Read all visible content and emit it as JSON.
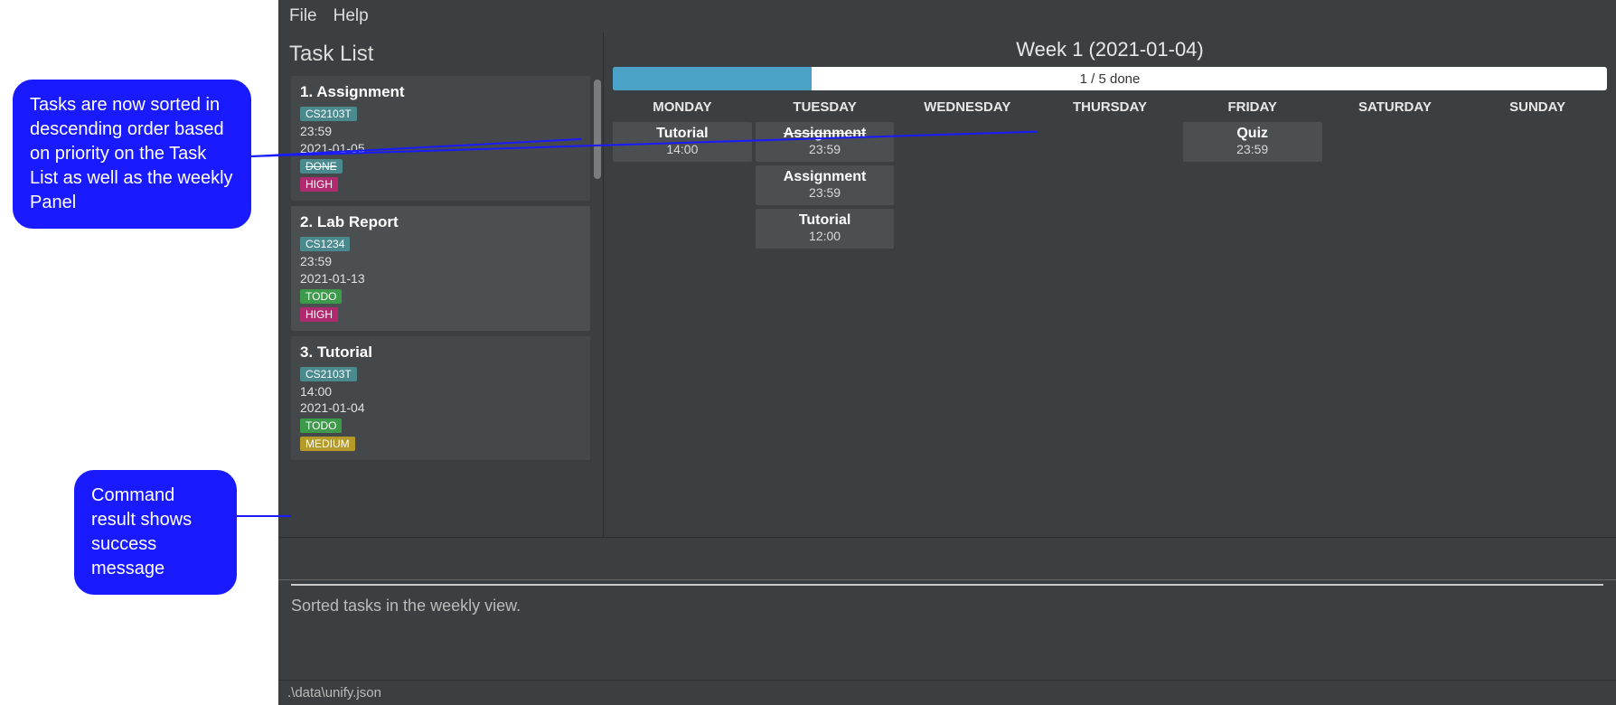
{
  "menubar": {
    "file": "File",
    "help": "Help"
  },
  "sidebar": {
    "title": "Task List",
    "tasks": [
      {
        "title": "1.  Assignment",
        "module": "CS2103T",
        "time": "23:59",
        "date": "2021-01-05",
        "status": "DONE",
        "status_kind": "done",
        "priority": "HIGH",
        "priority_kind": "high"
      },
      {
        "title": "2.  Lab Report",
        "module": "CS1234",
        "time": "23:59",
        "date": "2021-01-13",
        "status": "TODO",
        "status_kind": "todo",
        "priority": "HIGH",
        "priority_kind": "high"
      },
      {
        "title": "3.  Tutorial",
        "module": "CS2103T",
        "time": "14:00",
        "date": "2021-01-04",
        "status": "TODO",
        "status_kind": "todo",
        "priority": "MEDIUM",
        "priority_kind": "medium"
      }
    ]
  },
  "week": {
    "title": "Week 1 (2021-01-04)",
    "progress_label": "1 / 5 done",
    "progress_percent": 20,
    "days": [
      "MONDAY",
      "TUESDAY",
      "WEDNESDAY",
      "THURSDAY",
      "FRIDAY",
      "SATURDAY",
      "SUNDAY"
    ],
    "events": {
      "MONDAY": [
        {
          "title": "Tutorial",
          "time": "14:00",
          "done": false
        }
      ],
      "TUESDAY": [
        {
          "title": "Assignment",
          "time": "23:59",
          "done": true
        },
        {
          "title": "Assignment",
          "time": "23:59",
          "done": false
        },
        {
          "title": "Tutorial",
          "time": "12:00",
          "done": false
        }
      ],
      "WEDNESDAY": [],
      "THURSDAY": [],
      "FRIDAY": [
        {
          "title": "Quiz",
          "time": "23:59",
          "done": false
        }
      ],
      "SATURDAY": [],
      "SUNDAY": []
    }
  },
  "command_input": "",
  "result": "Sorted tasks in the weekly view.",
  "status": ".\\data\\unify.json",
  "callouts": {
    "top": "Tasks are now sorted in descending order based on priority on the Task List as well as the weekly Panel",
    "bottom": "Command result shows success message"
  },
  "colors": {
    "bg": "#3c3f41",
    "card": "#4b4f52",
    "accent_blue": "#4aa3c7",
    "callout": "#1a1aff",
    "badge_module": "#4a8a8f",
    "badge_todo": "#3d9a4a",
    "badge_high": "#b02a6f",
    "badge_medium": "#b59a2a"
  }
}
